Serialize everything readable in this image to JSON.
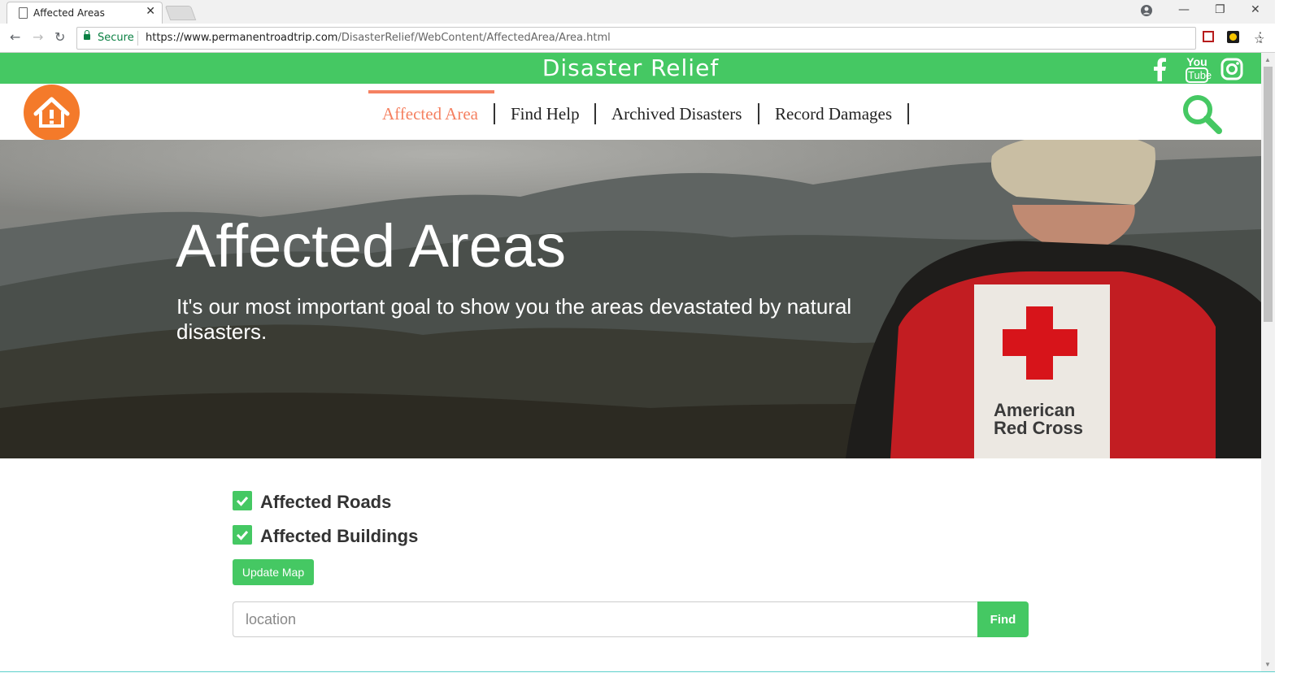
{
  "browser": {
    "tab_title": "Affected Areas",
    "tab_close": "✕",
    "secure_label": "Secure",
    "url_host": "https://www.permanentroadtrip.com",
    "url_path": "/DisasterRelief/WebContent/AffectedArea/Area.html",
    "star": "☆",
    "back": "←",
    "forward": "→",
    "reload": "↻",
    "menu": "⋮",
    "win_minimize": "—",
    "win_restore": "❐",
    "win_close": "✕"
  },
  "header": {
    "site_title": "Disaster Relief",
    "social_icons": [
      "facebook-icon",
      "youtube-icon",
      "instagram-icon"
    ],
    "youtube_text_top": "You",
    "youtube_text_bottom": "Tube"
  },
  "nav": {
    "items": [
      {
        "label": "Affected Area",
        "active": true
      },
      {
        "label": "Find Help",
        "active": false
      },
      {
        "label": "Archived Disasters",
        "active": false
      },
      {
        "label": "Record Damages",
        "active": false
      }
    ]
  },
  "hero": {
    "title": "Affected Areas",
    "subtitle": "It's our most important goal to show you the areas devastated by natural disasters.",
    "vest_text_line1": "American",
    "vest_text_line2": "Red Cross"
  },
  "filters": {
    "roads_label": "Affected Roads",
    "roads_checked": true,
    "buildings_label": "Affected Buildings",
    "buildings_checked": true,
    "update_button": "Update Map"
  },
  "search": {
    "placeholder": "location",
    "find_button": "Find"
  },
  "colors": {
    "brand_green": "#45c863",
    "accent_orange": "#f47a2a",
    "nav_active": "#f58161"
  }
}
